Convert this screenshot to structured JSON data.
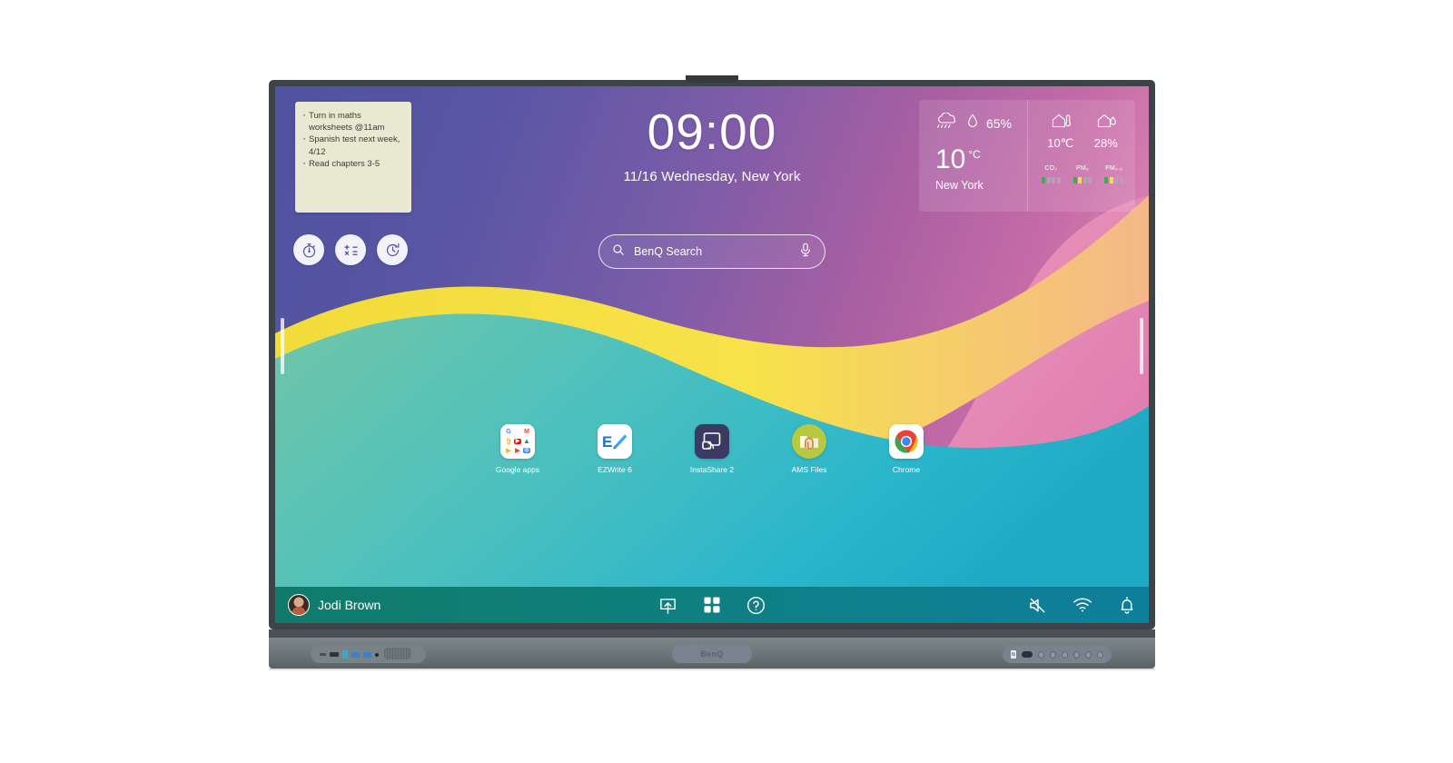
{
  "device": {
    "brand_logo": "BenQ",
    "camera_notch": "camera-notch"
  },
  "note_widget": {
    "lines": [
      "Turn in maths worksheets @11am",
      "Spanish test next week, 4/12",
      "Read chapters 3-5"
    ]
  },
  "clock": {
    "time": "09:00",
    "date": "11/16 Wednesday, New York"
  },
  "weather": {
    "condition_icon": "rain-cloud-icon",
    "humidity_icon": "water-drop-icon",
    "humidity": "65%",
    "temperature": "10",
    "unit": "°C",
    "city": "New York",
    "indoor": [
      {
        "icon": "home-thermometer-icon",
        "value": "10℃"
      },
      {
        "icon": "home-humidity-icon",
        "value": "28%"
      }
    ],
    "air_quality": [
      {
        "label": "CO₂",
        "filled": 1,
        "total": 4,
        "color": "#35b24a"
      },
      {
        "label": "PM₆",
        "filled": 2,
        "total": 4,
        "color": "#35b24a",
        "second_color": "#e9e24c"
      },
      {
        "label": "PM₂.₅",
        "filled": 2,
        "total": 4,
        "color": "#35b24a",
        "second_color": "#e9e24c"
      }
    ]
  },
  "quick_tools": [
    {
      "name": "stopwatch-icon",
      "label": "Stopwatch"
    },
    {
      "name": "calculator-icon",
      "label": "Calculator"
    },
    {
      "name": "timer-icon",
      "label": "Timer"
    }
  ],
  "search": {
    "placeholder": "BenQ Search",
    "search_icon": "search-icon",
    "mic_icon": "microphone-icon"
  },
  "apps": [
    {
      "label": "Google apps",
      "icon": "google-apps-grid-icon"
    },
    {
      "label": "EZWrite 6",
      "icon": "ezwrite-icon"
    },
    {
      "label": "InstaShare 2",
      "icon": "instashare-icon"
    },
    {
      "label": "AMS Files",
      "icon": "ams-files-icon"
    },
    {
      "label": "Chrome",
      "icon": "chrome-icon"
    }
  ],
  "google_grid": [
    {
      "glyph": "G",
      "bg": "#ffffff",
      "fg": "#4285f4"
    },
    {
      "glyph": "●",
      "bg": "#ffffff",
      "fg": "#ea4335"
    },
    {
      "glyph": "M",
      "bg": "#ffffff",
      "fg": "#ea4335"
    },
    {
      "glyph": "◑",
      "bg": "#ffffff",
      "fg": "#fbbc05"
    },
    {
      "glyph": "▶",
      "bg": "#ffffff",
      "fg": "#ff0000"
    },
    {
      "glyph": "△",
      "bg": "#ffffff",
      "fg": "#0f9d58"
    },
    {
      "glyph": "▶",
      "bg": "#ffffff",
      "fg": "#fbbc05"
    },
    {
      "glyph": "▷",
      "bg": "#ffffff",
      "fg": "#ea4335"
    },
    {
      "glyph": "◎",
      "bg": "#ffffff",
      "fg": "#4285f4"
    }
  ],
  "taskbar": {
    "username": "Jodi Brown",
    "avatar": "user-avatar",
    "center_icons": [
      {
        "name": "screen-share-icon"
      },
      {
        "name": "apps-grid-icon"
      },
      {
        "name": "help-icon"
      }
    ],
    "right_icons": [
      {
        "name": "volume-mute-icon"
      },
      {
        "name": "wifi-icon"
      },
      {
        "name": "notification-bell-icon"
      }
    ]
  },
  "colors": {
    "taskbar_start": "#107b6b",
    "taskbar_end": "#0e7f9b",
    "note_bg": "#e9e9d2",
    "wall_yellow": "#f5dd3c",
    "wall_teal": "#37bfc6",
    "wall_green": "#6fc4a6",
    "wall_pink": "#e58ab6"
  }
}
